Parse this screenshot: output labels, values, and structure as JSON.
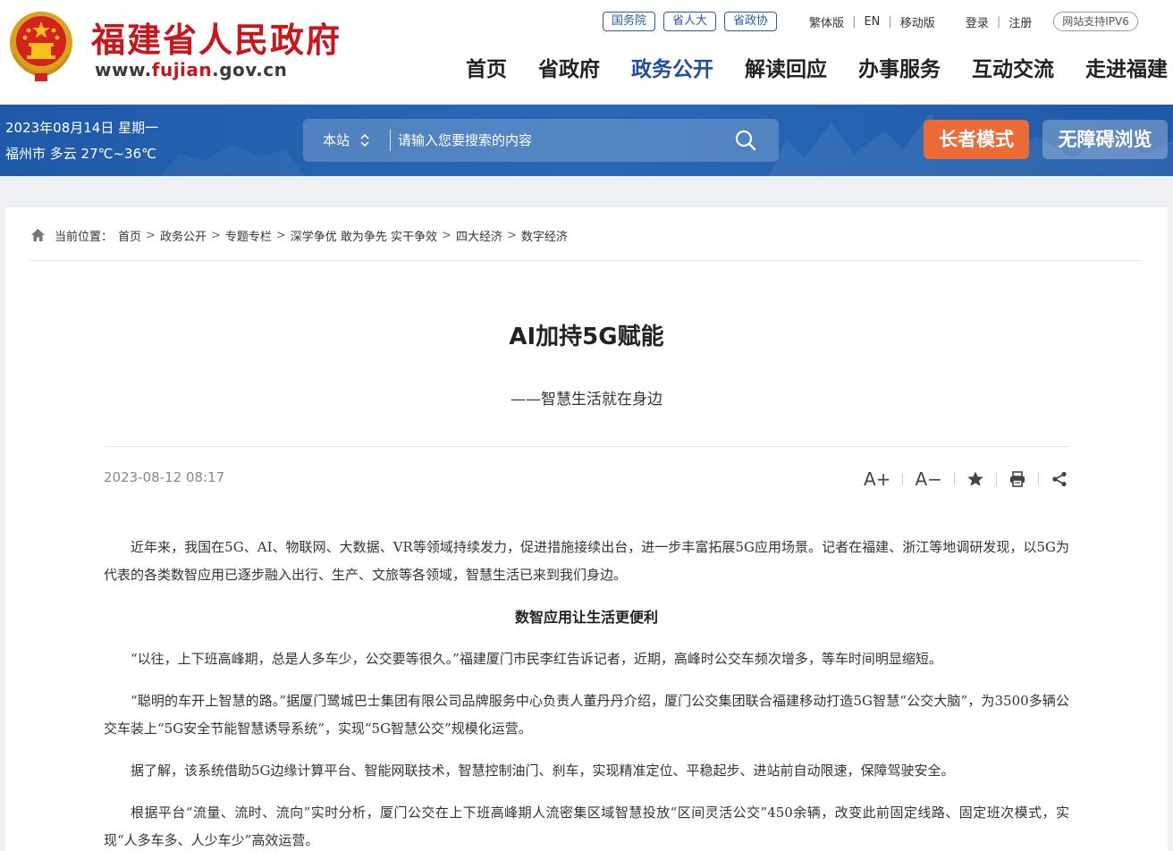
{
  "header": {
    "site_name": "福建省人民政府",
    "domain_prefix": "www.",
    "domain_highlight": "fujian",
    "domain_suffix": ".gov.cn",
    "top_links": {
      "guowuyuan": "国务院",
      "shengrenda": "省人大",
      "shengzhengxie": "省政协",
      "traditional": "繁体版",
      "english": "EN",
      "mobile": "移动版",
      "login": "登录",
      "register": "注册",
      "ipv6": "网站支持IPV6"
    },
    "nav": [
      "首页",
      "省政府",
      "政务公开",
      "解读回应",
      "办事服务",
      "互动交流",
      "走进福建"
    ],
    "active_nav": "政务公开"
  },
  "band": {
    "date": "2023年08月14日 星期一",
    "weather": "福州市 多云 27℃~36℃",
    "search": {
      "scope": "本站",
      "placeholder": "请输入您要搜索的内容"
    },
    "elder_mode": "长者模式",
    "accessibility": "无障碍浏览"
  },
  "breadcrumb": {
    "prefix": "当前位置：",
    "items": [
      "首页",
      "政务公开",
      "专题专栏",
      "深学争优 敢为争先 实干争效",
      "四大经济",
      "数字经济"
    ]
  },
  "article": {
    "title": "AI加持5G赋能",
    "subtitle": "——智慧生活就在身边",
    "date": "2023-08-12 08:17",
    "tools": {
      "font_larger": "A+",
      "font_smaller": "A−"
    },
    "paragraphs": [
      "近年来，我国在5G、AI、物联网、大数据、VR等领域持续发力，促进措施接续出台，进一步丰富拓展5G应用场景。记者在福建、浙江等地调研发现，以5G为代表的各类数智应用已逐步融入出行、生产、文旅等各领域，智慧生活已来到我们身边。",
      "数智应用让生活更便利",
      "“以往，上下班高峰期，总是人多车少，公交要等很久。”福建厦门市民李红告诉记者，近期，高峰时公交车频次增多，等车时间明显缩短。",
      "“聪明的车开上智慧的路。”据厦门鹭城巴士集团有限公司品牌服务中心负责人董丹丹介绍，厦门公交集团联合福建移动打造5G智慧“公交大脑”，为3500多辆公交车装上“5G安全节能智慧诱导系统”，实现“5G智慧公交”规模化运营。",
      "据了解，该系统借助5G边缘计算平台、智能网联技术，智慧控制油门、刹车，实现精准定位、平稳起步、进站前自动限速，保障驾驶安全。",
      "根据平台“流量、流时、流向”实时分析，厦门公交在上下班高峰期人流密集区域智慧投放“区间灵活公交”450余辆，改变此前固定线路、固定班次模式，实现“人多车多、人少车少”高效运营。"
    ]
  },
  "colors": {
    "brand_red": "#c8161d",
    "nav_active": "#1d4ea0",
    "band_blue": "#2463b0",
    "elder_orange": "#eb6a36"
  }
}
